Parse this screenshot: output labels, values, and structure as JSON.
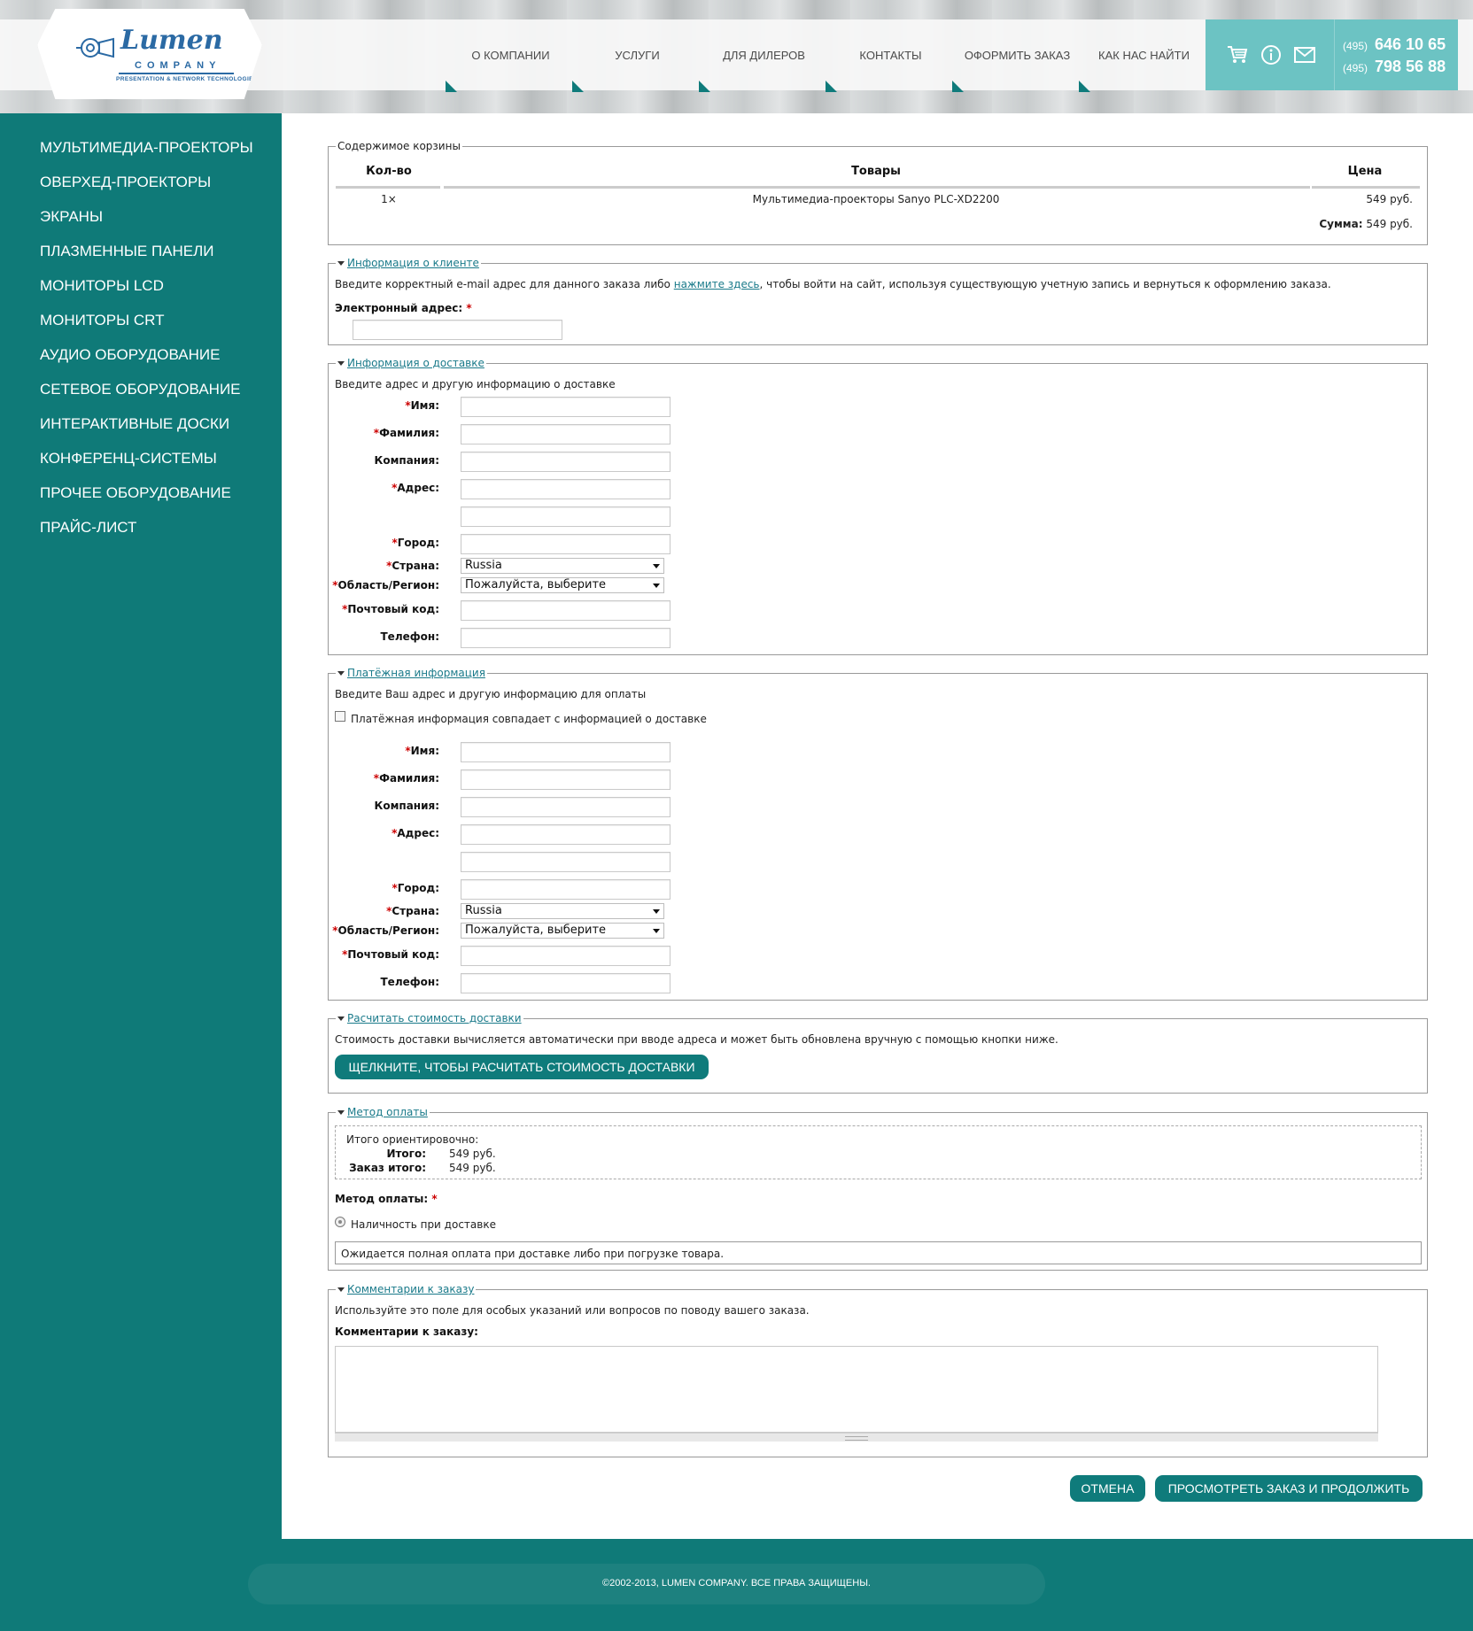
{
  "brand": {
    "name": "Lumen",
    "company": "COMPANY",
    "tagline": "PRESENTATION & NETWORK TECHNOLOGIES",
    "accent_color": "#0f7a78",
    "header_box_color": "#6cc3c3",
    "link_color": "#1a7a8a"
  },
  "nav": {
    "items": [
      "О КОМПАНИИ",
      "УСЛУГИ",
      "ДЛЯ ДИЛЕРОВ",
      "КОНТАКТЫ",
      "ОФОРМИТЬ ЗАКАЗ",
      "КАК НАС НАЙТИ"
    ]
  },
  "contacts": {
    "icons": [
      "cart-icon",
      "info-icon",
      "mail-icon"
    ],
    "phones": [
      {
        "code": "(495)",
        "number": "646 10 65"
      },
      {
        "code": "(495)",
        "number": "798 56 88"
      }
    ]
  },
  "sidebar": {
    "items": [
      "МУЛЬТИМЕДИА-ПРОЕКТОРЫ",
      "ОВЕРХЕД-ПРОЕКТОРЫ",
      "ЭКРАНЫ",
      "ПЛАЗМЕННЫЕ ПАНЕЛИ",
      "МОНИТОРЫ LCD",
      "МОНИТОРЫ CRT",
      "АУДИО ОБОРУДОВАНИЕ",
      "СЕТЕВОЕ ОБОРУДОВАНИЕ",
      "ИНТЕРАКТИВНЫЕ ДОСКИ",
      "КОНФЕРЕНЦ-СИСТЕМЫ",
      "ПРОЧЕЕ ОБОРУДОВАНИЕ",
      "ПРАЙС-ЛИСТ"
    ]
  },
  "cart": {
    "legend": "Содержимое корзины",
    "col_qty": "Кол-во",
    "col_products": "Товары",
    "col_price": "Цена",
    "row": {
      "qty": "1×",
      "product": "Мультимедиа-проекторы Sanyo PLC-XD2200",
      "price": "549 руб."
    },
    "sum_label": "Сумма:",
    "sum_value": "549 руб."
  },
  "customer": {
    "legend": "Информация о клиенте",
    "intro_before": "Введите корректный e-mail адрес для данного заказа либо ",
    "intro_link": "нажмите здесь",
    "intro_after": ", чтобы войти на сайт, используя существующую учетную запись и вернуться к оформлению заказа.",
    "email_label": "Электронный адрес:",
    "required_mark": "*",
    "email_value": ""
  },
  "delivery": {
    "legend": "Информация о доставке",
    "intro": "Введите адрес и другую информацию о доставке",
    "first_name": "Имя:",
    "last_name": "Фамилия:",
    "company": "Компания:",
    "address": "Адрес:",
    "city": "Город:",
    "country": "Страна:",
    "country_value": "Russia",
    "region": "Область/Регион:",
    "region_value": "Пожалуйста, выберите",
    "zip": "Почтовый код:",
    "phone": "Телефон:"
  },
  "billing": {
    "legend": "Платёжная информация",
    "intro": "Введите Ваш адрес и другую информацию для оплаты",
    "same_checkbox": "Платёжная информация совпадает с информацией о доставке",
    "first_name": "Имя:",
    "last_name": "Фамилия:",
    "company": "Компания:",
    "address": "Адрес:",
    "city": "Город:",
    "country": "Страна:",
    "country_value": "Russia",
    "region": "Область/Регион:",
    "region_value": "Пожалуйста, выберите",
    "zip": "Почтовый код:",
    "phone": "Телефон:"
  },
  "shipping_calc": {
    "legend": "Расчитать стоимость доставки",
    "intro": "Стоимость доставки вычисляется автоматически при вводе адреса и может быть обновлена вручную с помощью кнопки ниже.",
    "button": "ЩЕЛКНИТЕ, ЧТОБЫ РАСЧИТАТЬ СТОИМОСТЬ ДОСТАВКИ"
  },
  "payment": {
    "legend": "Метод оплаты",
    "summary_title": "Итого ориентировочно:",
    "subtotal_label": "Итого:",
    "subtotal_value": "549 руб.",
    "order_total_label": "Заказ итого:",
    "order_total_value": "549 руб.",
    "method_label": "Метод оплаты:",
    "option": "Наличность при доставке",
    "note": "Ожидается полная оплата при доставке либо при погрузке товара."
  },
  "comments": {
    "legend": "Комментарии к заказу",
    "intro": "Используйте это поле для особых указаний или вопросов по поводу вашего заказа.",
    "label": "Комментарии к заказу:",
    "value": ""
  },
  "actions": {
    "cancel": "ОТМЕНА",
    "review": "ПРОСМОТРЕТЬ ЗАКАЗ И ПРОДОЛЖИТЬ"
  },
  "footer": {
    "copyright": "©2002-2013, LUMEN COMPANY. ВСЕ ПРАВА ЗАЩИЩЕНЫ."
  }
}
